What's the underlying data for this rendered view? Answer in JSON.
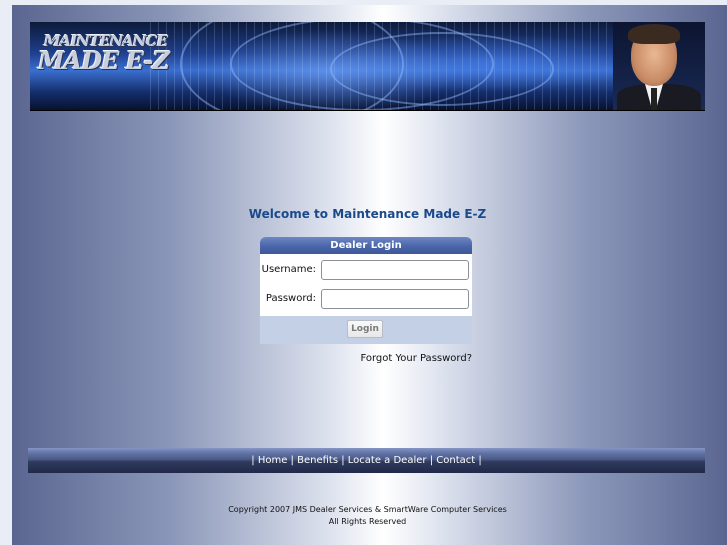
{
  "header": {
    "logo_line1": "MAINTENANCE",
    "logo_line2": "MADE E-Z"
  },
  "welcome": {
    "title": "Welcome to Maintenance Made E-Z"
  },
  "login": {
    "title": "Dealer Login",
    "username_label": "Username:",
    "username_value": "",
    "password_label": "Password:",
    "password_value": "",
    "submit_label": "Login",
    "forgot_link": "Forgot Your Password?"
  },
  "nav": {
    "items": [
      "Home",
      "Benefits",
      "Locate a Dealer",
      "Contact"
    ],
    "separator": "|"
  },
  "footer": {
    "line1": "Copyright 2007 JMS Dealer Services & SmartWare Computer Services",
    "line2": "All Rights Reserved"
  },
  "colors": {
    "heading": "#1b4a8a",
    "login_header": "#4a66aa",
    "login_footer": "#c3d0e6",
    "nav_bar": "#2f3a5c"
  }
}
